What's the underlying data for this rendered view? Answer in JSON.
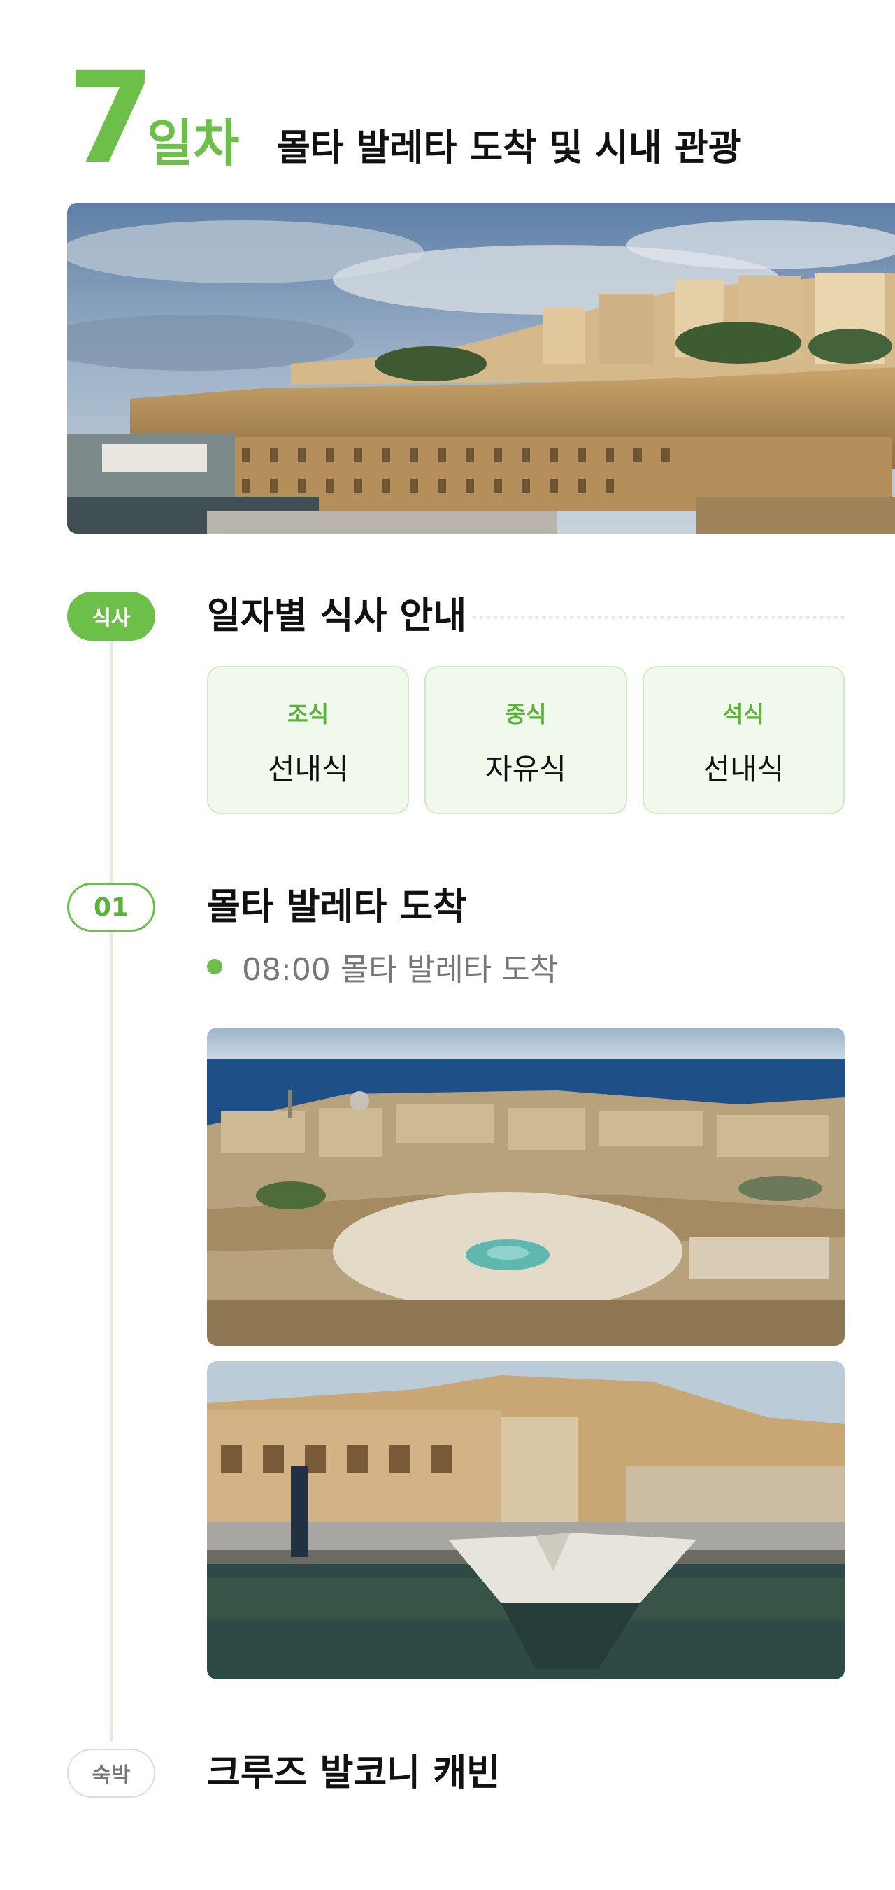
{
  "header": {
    "day_number": "7",
    "day_word": "일차",
    "title": "몰타 발레타 도착 및 시내 관광"
  },
  "meals": {
    "badge": "식사",
    "title": "일자별 식사 안내",
    "items": [
      {
        "label": "조식",
        "value": "선내식"
      },
      {
        "label": "중식",
        "value": "자유식"
      },
      {
        "label": "석식",
        "value": "선내식"
      }
    ]
  },
  "schedule": {
    "badge": "01",
    "title": "몰타 발레타 도착",
    "items": [
      {
        "text": "08:00 몰타 발레타 도착"
      }
    ]
  },
  "stay": {
    "badge": "숙박",
    "title": "크루즈 발코니 캐빈"
  },
  "colors": {
    "accent": "#6cc04a",
    "light_green_bg": "#f1f9ec",
    "timeline_line": "#dff0d5"
  }
}
